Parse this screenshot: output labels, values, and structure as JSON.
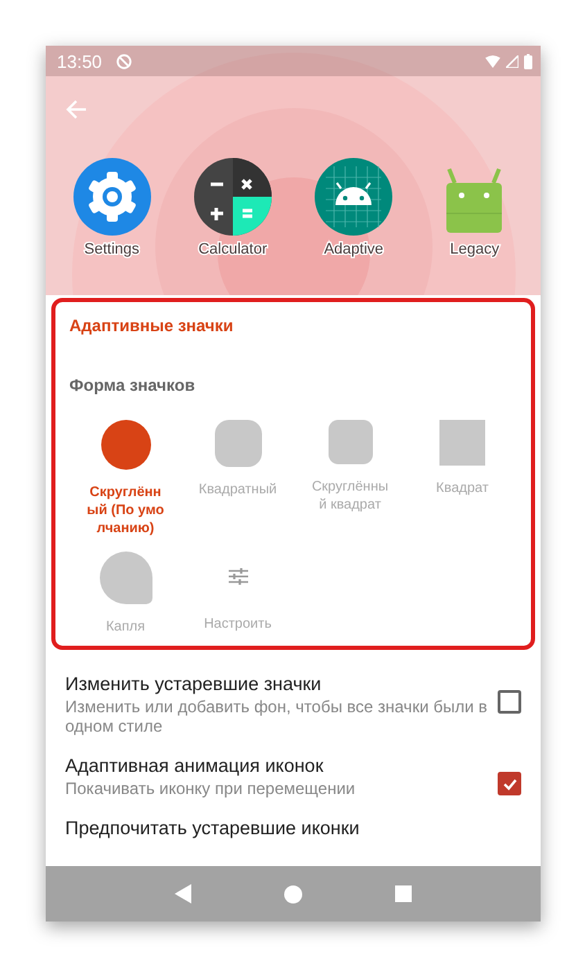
{
  "status_bar": {
    "time": "13:50"
  },
  "preview_apps": [
    {
      "label": "Settings",
      "kind": "settings"
    },
    {
      "label": "Calculator",
      "kind": "calculator"
    },
    {
      "label": "Adaptive",
      "kind": "adaptive"
    },
    {
      "label": "Legacy",
      "kind": "legacy"
    }
  ],
  "section_title": "Адаптивные значки",
  "shape_title": "Форма значков",
  "shapes": [
    {
      "label": "Скруглённый (По умолчанию)",
      "kind": "circle",
      "selected": true
    },
    {
      "label": "Квадратный",
      "kind": "squircle",
      "selected": false
    },
    {
      "label": "Скруглённый квадрат",
      "kind": "rounded",
      "selected": false
    },
    {
      "label": "Квадрат",
      "kind": "square",
      "selected": false
    },
    {
      "label": "Капля",
      "kind": "teardrop",
      "selected": false
    },
    {
      "label": "Настроить",
      "kind": "custom",
      "selected": false
    }
  ],
  "settings": [
    {
      "title": "Изменить устаревшие значки",
      "subtitle": "Изменить или добавить фон, чтобы все значки были в одном стиле",
      "checked": false
    },
    {
      "title": "Адаптивная анимация иконок",
      "subtitle": "Покачивать иконку при перемещении",
      "checked": true
    },
    {
      "title": "Предпочитать устаревшие иконки"
    }
  ]
}
